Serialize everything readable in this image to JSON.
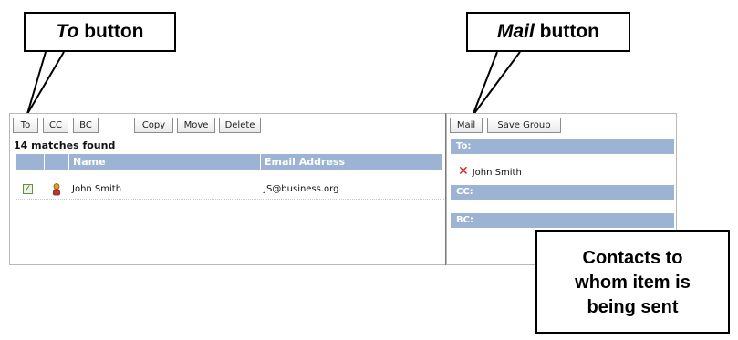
{
  "toolbar": {
    "to": "To",
    "cc": "CC",
    "bc": "BC",
    "copy": "Copy",
    "move": "Move",
    "delete": "Delete"
  },
  "results": {
    "count_text": "14 matches found",
    "columns": [
      "",
      "",
      "Name",
      "Email Address"
    ],
    "rows": [
      {
        "checked": true,
        "icon": "person-icon",
        "name": "John  Smith",
        "email": "JS@business.org"
      }
    ]
  },
  "right_toolbar": {
    "mail": "Mail",
    "save_group": "Save Group"
  },
  "recipients": {
    "to_label": "To:",
    "cc_label": "CC:",
    "bc_label": "BC:",
    "to_list": [
      "John  Smith"
    ]
  },
  "callouts": {
    "to_button": {
      "emph": "To",
      "rest": " button"
    },
    "mail_button": {
      "emph": "Mail",
      "rest": " button"
    },
    "contacts": [
      "Contacts to",
      "whom item is",
      "being sent"
    ]
  },
  "colors": {
    "header_blue": "#9cb3d4",
    "remove_red": "#d62020"
  }
}
